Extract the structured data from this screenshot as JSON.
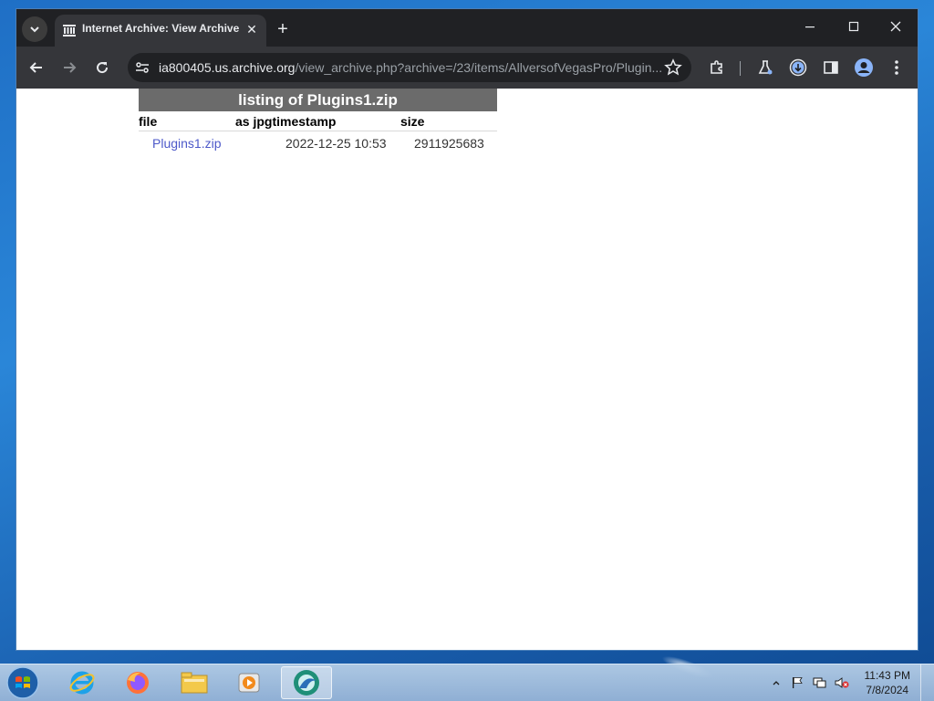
{
  "browser": {
    "tab": {
      "title": "Internet Archive: View Archive",
      "close_glyph": "✕"
    },
    "new_tab_glyph": "+",
    "window_controls": {
      "minimize": "—",
      "maximize": "☐",
      "close": "✕"
    },
    "address": {
      "host": "ia800405.us.archive.org",
      "path": "/view_archive.php?archive=/23/items/AllversofVegasPro/Plugin..."
    }
  },
  "page": {
    "listing": {
      "title": "listing of Plugins1.zip",
      "columns": {
        "file": "file",
        "as_jpg_timestamp": "as jpgtimestamp",
        "size": "size"
      },
      "rows": [
        {
          "file": "Plugins1.zip",
          "timestamp": "2022-12-25 10:53",
          "size": "2911925683"
        }
      ]
    }
  },
  "taskbar": {
    "apps": [
      "start-orb",
      "internet-explorer-icon",
      "firefox-icon",
      "file-explorer-icon",
      "media-player-icon",
      "chrome-app-icon"
    ],
    "clock": {
      "time": "11:43 PM",
      "date": "7/8/2024"
    }
  },
  "colors": {
    "titlebar": "#202124",
    "toolbar": "#35363a",
    "listing_header": "#6b6b6b",
    "link": "#4d59c9"
  }
}
